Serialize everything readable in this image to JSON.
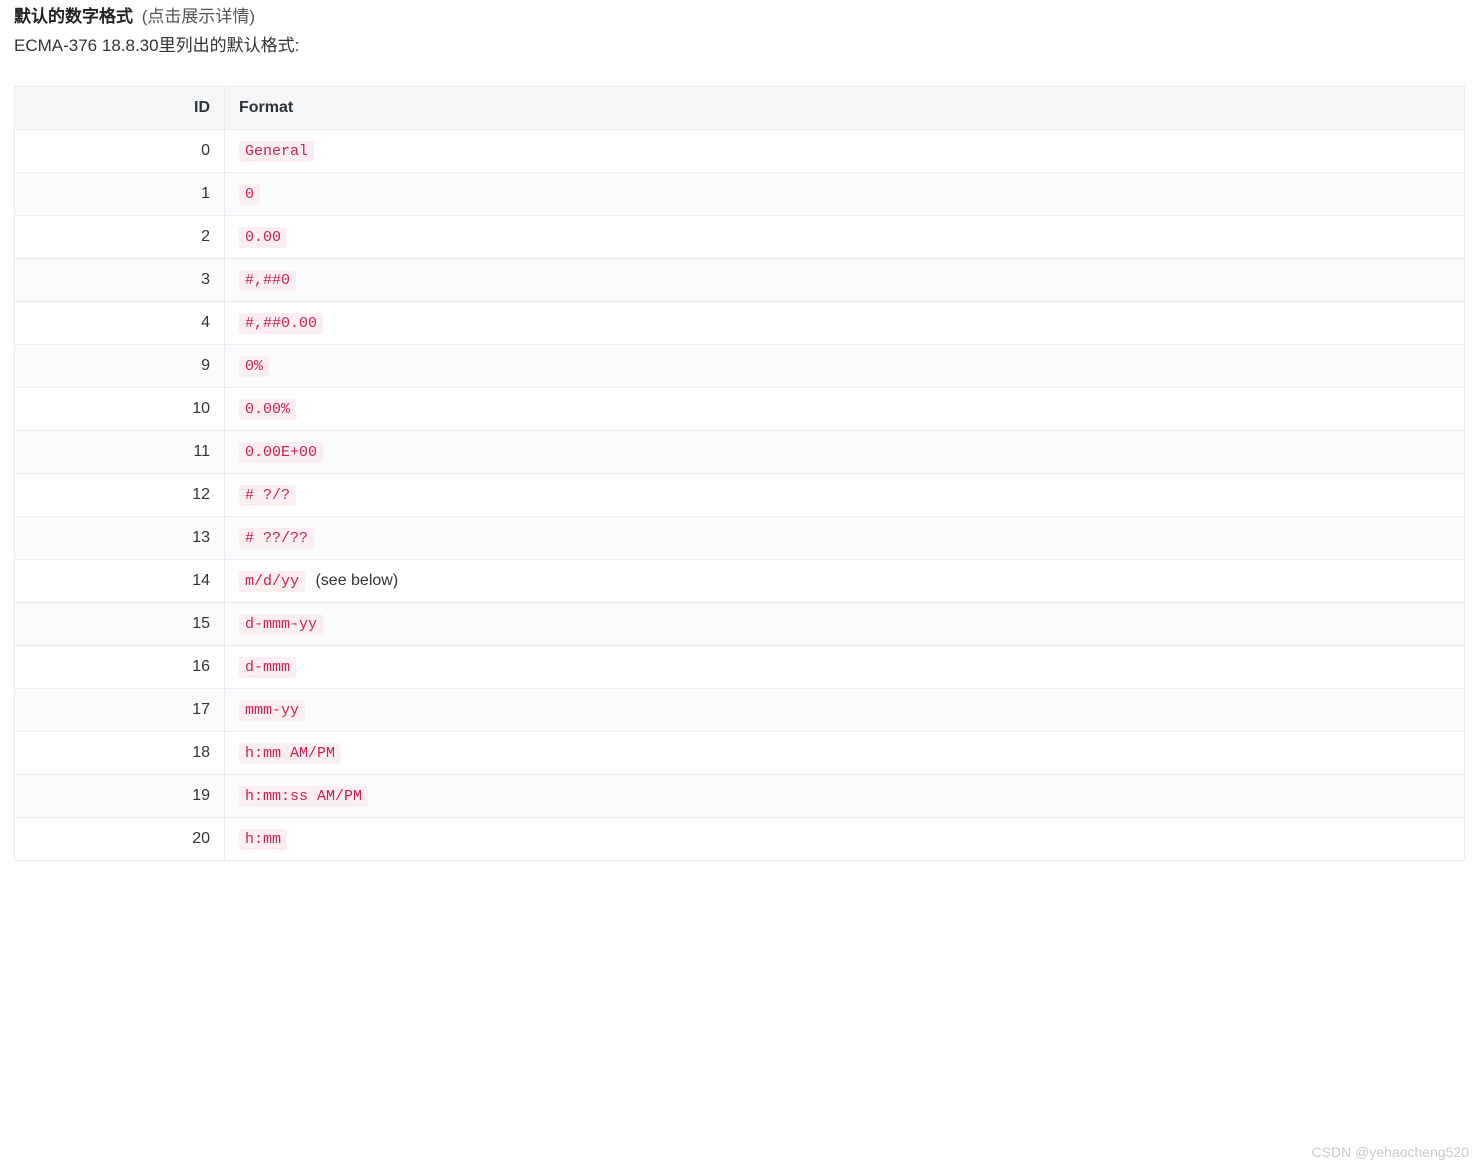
{
  "heading": {
    "title": "默认的数字格式",
    "hint": "(点击展示详情)"
  },
  "subheading": "ECMA-376 18.8.30里列出的默认格式:",
  "table": {
    "headers": {
      "id": "ID",
      "format": "Format"
    },
    "rows": [
      {
        "id": "0",
        "code": "General",
        "suffix": ""
      },
      {
        "id": "1",
        "code": "0",
        "suffix": ""
      },
      {
        "id": "2",
        "code": "0.00",
        "suffix": ""
      },
      {
        "id": "3",
        "code": "#,##0",
        "suffix": ""
      },
      {
        "id": "4",
        "code": "#,##0.00",
        "suffix": ""
      },
      {
        "id": "9",
        "code": "0%",
        "suffix": ""
      },
      {
        "id": "10",
        "code": "0.00%",
        "suffix": ""
      },
      {
        "id": "11",
        "code": "0.00E+00",
        "suffix": ""
      },
      {
        "id": "12",
        "code": "# ?/?",
        "suffix": ""
      },
      {
        "id": "13",
        "code": "# ??/??",
        "suffix": ""
      },
      {
        "id": "14",
        "code": "m/d/yy",
        "suffix": "(see below)"
      },
      {
        "id": "15",
        "code": "d-mmm-yy",
        "suffix": ""
      },
      {
        "id": "16",
        "code": "d-mmm",
        "suffix": ""
      },
      {
        "id": "17",
        "code": "mmm-yy",
        "suffix": ""
      },
      {
        "id": "18",
        "code": "h:mm AM/PM",
        "suffix": ""
      },
      {
        "id": "19",
        "code": "h:mm:ss AM/PM",
        "suffix": ""
      },
      {
        "id": "20",
        "code": "h:mm",
        "suffix": ""
      }
    ]
  },
  "watermark": "CSDN @yehaocheng520"
}
